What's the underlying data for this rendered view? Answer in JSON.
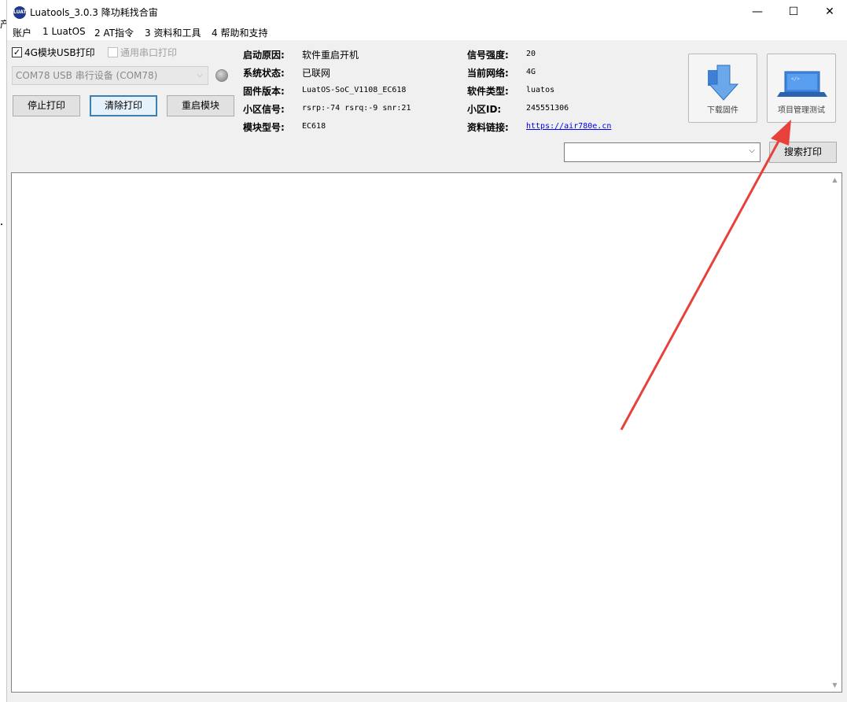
{
  "window": {
    "title": "Luatools_3.0.3 降功耗找合宙",
    "icon_label": "LUAT",
    "minimize": "—",
    "maximize": "☐",
    "close": "✕"
  },
  "left_stub": "产",
  "menu": [
    "账户",
    "1 LuatOS",
    "2 AT指令",
    "3 资料和工具",
    "4 帮助和支持"
  ],
  "controls": {
    "usb_print": {
      "label": "4G模块USB打印",
      "checked": true
    },
    "serial_print": {
      "label": "通用串口打印",
      "checked": false
    },
    "port_select": "COM78 USB 串行设备 (COM78)",
    "stop_button": "停止打印",
    "clear_button": "清除打印",
    "restart_button": "重启模块"
  },
  "info": {
    "boot_reason": {
      "label": "启动原因:",
      "value": "软件重启开机"
    },
    "system_status": {
      "label": "系统状态:",
      "value": "已联网"
    },
    "firmware": {
      "label": "固件版本:",
      "value": "LuatOS-SoC_V1108_EC618"
    },
    "cell_signal": {
      "label": "小区信号:",
      "value": "rsrp:-74 rsrq:-9 snr:21"
    },
    "module_model": {
      "label": "模块型号:",
      "value": "EC618"
    },
    "signal_strength": {
      "label": "信号强度:",
      "value": "20"
    },
    "network": {
      "label": "当前网络:",
      "value": "4G"
    },
    "software_type": {
      "label": "软件类型:",
      "value": "luatos"
    },
    "cell_id": {
      "label": "小区ID:",
      "value": "245551306"
    },
    "doc_link": {
      "label": "资料链接:",
      "value": "https://air780e.cn"
    }
  },
  "tools": {
    "download_firmware": "下载固件",
    "project_test": "项目管理测试",
    "search_print": "搜索打印",
    "search_value": ""
  },
  "colors": {
    "accent": "#3c7fb1",
    "link": "#0000ee",
    "annotation_arrow": "#e8413b"
  }
}
